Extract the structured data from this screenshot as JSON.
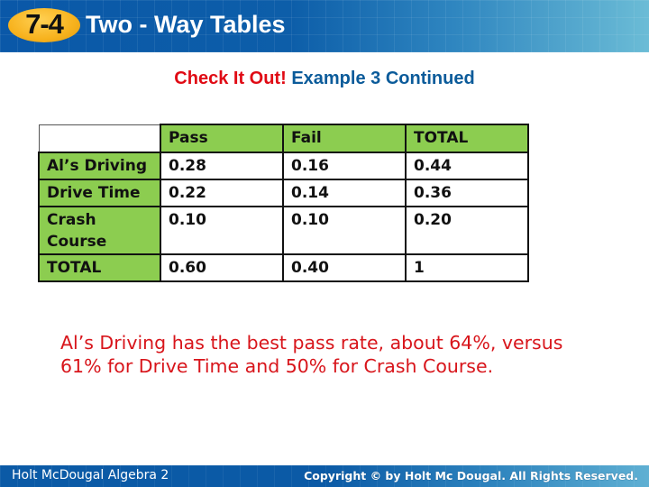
{
  "header": {
    "lesson_number": "7-4",
    "lesson_title": "Two - Way Tables"
  },
  "subtitle": {
    "prefix": "Check It Out!",
    "text": "Example 3 Continued"
  },
  "table": {
    "columns": [
      "",
      "Pass",
      "Fail",
      "TOTAL"
    ],
    "rows": [
      {
        "label": "Al’s Driving",
        "values": [
          "0.28",
          "0.16",
          "0.44"
        ]
      },
      {
        "label": "Drive Time",
        "values": [
          "0.22",
          "0.14",
          "0.36"
        ]
      },
      {
        "label": "Crash Course",
        "values": [
          "0.10",
          "0.10",
          "0.20"
        ]
      },
      {
        "label": "TOTAL",
        "values": [
          "0.60",
          "0.40",
          "1"
        ]
      }
    ]
  },
  "note": "Al’s Driving has the best pass rate, about 64%, versus 61% for Drive Time and 50% for Crash Course.",
  "footer": {
    "left": "Holt McDougal Algebra 2",
    "right": "Copyright © by Holt Mc Dougal. All Rights Reserved."
  },
  "colors": {
    "banner_blue": "#0a58a8",
    "badge_orange": "#f7b21d",
    "check_it_out_red": "#e00a14",
    "example_blue": "#0b5b9a",
    "table_header_green": "#8ccd50",
    "note_red": "#d8151b"
  }
}
